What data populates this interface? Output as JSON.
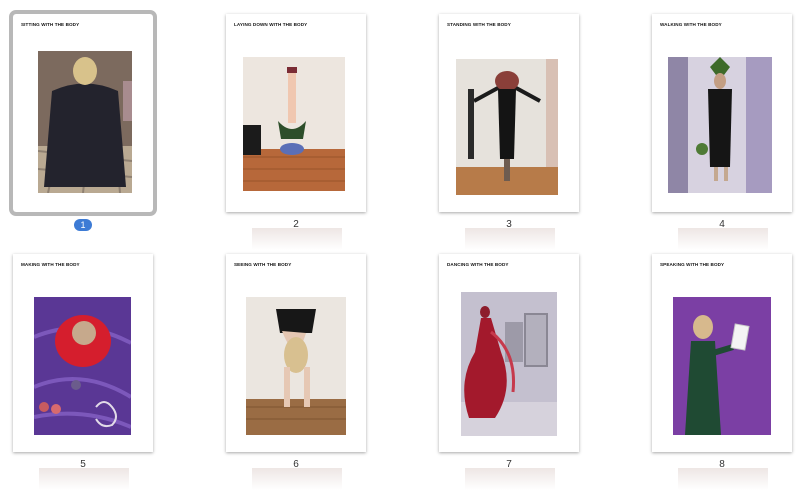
{
  "pages": [
    {
      "number": "1",
      "title": "SITTING WITH THE BODY",
      "selected": true
    },
    {
      "number": "2",
      "title": "LAYING DOWN WITH THE BODY",
      "selected": false
    },
    {
      "number": "3",
      "title": "STANDING WITH THE BODY",
      "selected": false
    },
    {
      "number": "4",
      "title": "WALKING WITH THE BODY",
      "selected": false
    },
    {
      "number": "5",
      "title": "MAKING WITH THE BODY",
      "selected": false
    },
    {
      "number": "6",
      "title": "SEEING WITH THE BODY",
      "selected": false
    },
    {
      "number": "7",
      "title": "DANCING WITH THE BODY",
      "selected": false
    },
    {
      "number": "8",
      "title": "SPEAKING WITH THE BODY",
      "selected": false
    }
  ],
  "colors": {
    "selection_badge": "#3d7bd5",
    "selection_outline": "#b8b8b8",
    "background": "#ffffff"
  }
}
